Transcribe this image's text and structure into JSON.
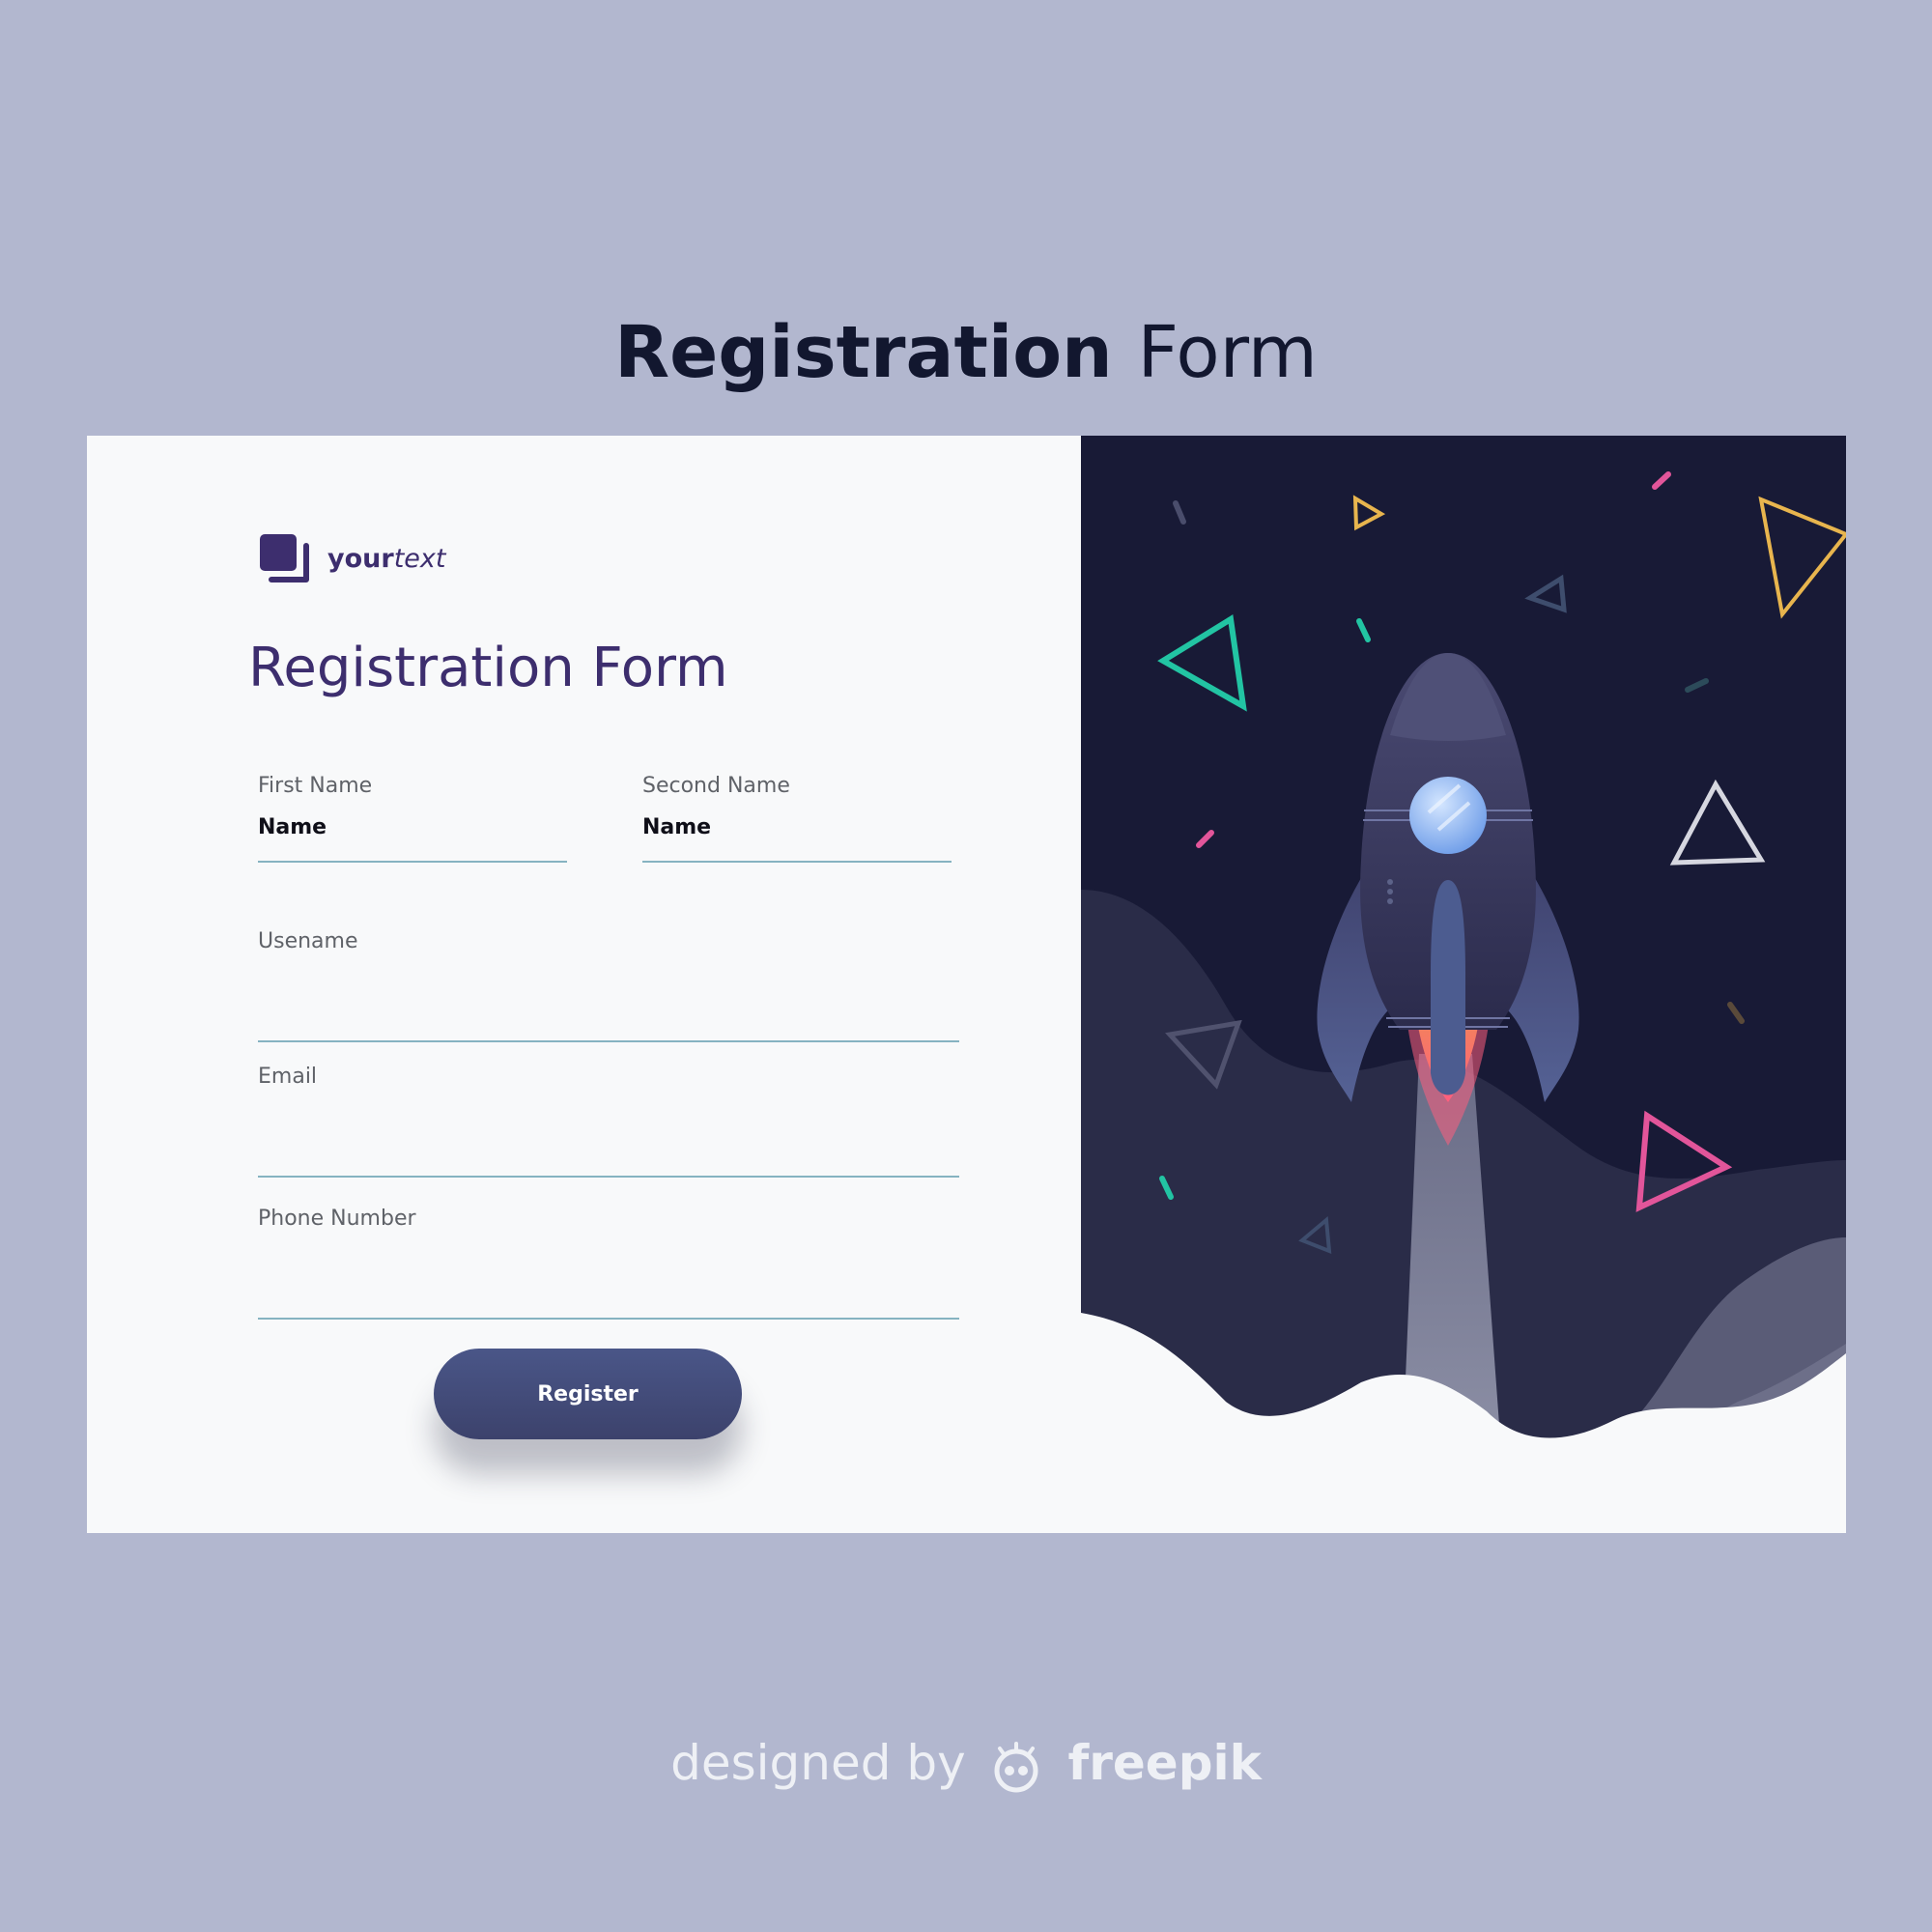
{
  "page": {
    "heading_bold": "Registration",
    "heading_light": "Form",
    "credit_prefix": "designed by",
    "credit_brand": "freepik"
  },
  "logo": {
    "text_bold": "your",
    "text_italic": "text",
    "icon": "layered-squares-icon"
  },
  "form": {
    "title": "Registration Form",
    "fields": {
      "first_name": {
        "label": "First Name",
        "placeholder": "Name"
      },
      "second_name": {
        "label": "Second Name",
        "placeholder": "Name"
      },
      "username": {
        "label": "Usename",
        "placeholder": ""
      },
      "email": {
        "label": "Email",
        "placeholder": ""
      },
      "phone": {
        "label": "Phone Number",
        "placeholder": ""
      }
    },
    "submit_label": "Register"
  },
  "illustration": {
    "subject": "rocket-launch",
    "icons": [
      "rocket-icon",
      "triangle-icon",
      "confetti-icon",
      "cloud-icon"
    ]
  },
  "colors": {
    "background": "#b2b7cf",
    "card": "#f8f9fa",
    "space": "#181a36",
    "accent_purple": "#3d2e6e",
    "button": "#434d7c",
    "input_underline": "#86b3c1",
    "teal": "#22c4a3",
    "yellow": "#e8b54e",
    "pink": "#e2559a"
  }
}
